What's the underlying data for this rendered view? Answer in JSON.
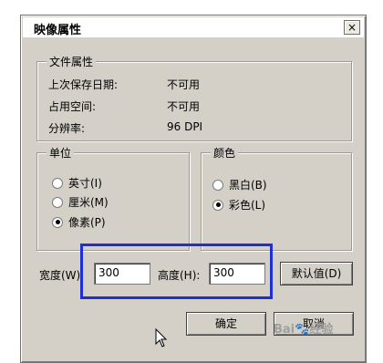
{
  "dialog": {
    "title": "映像属性",
    "close_glyph": "×"
  },
  "file_props": {
    "title": "文件属性",
    "rows": [
      {
        "label": "上次保存日期:",
        "value": "不可用"
      },
      {
        "label": "占用空间:",
        "value": "不可用"
      },
      {
        "label": "分辨率:",
        "value": "96 DPI"
      }
    ]
  },
  "unit": {
    "title": "单位",
    "options": [
      {
        "label": "英寸(I)",
        "selected": false
      },
      {
        "label": "厘米(M)",
        "selected": false
      },
      {
        "label": "像素(P)",
        "selected": true
      }
    ]
  },
  "color": {
    "title": "颜色",
    "options": [
      {
        "label": "黑白(B)",
        "selected": false
      },
      {
        "label": "彩色(L)",
        "selected": true
      }
    ]
  },
  "size": {
    "width_label": "宽度(W)",
    "width_value": "300",
    "height_label": "高度(H):",
    "height_value": "300",
    "default_button": "默认值(D)"
  },
  "buttons": {
    "ok": "确定",
    "cancel": "取消"
  },
  "watermark": "Bai🐾经验",
  "colors": {
    "highlight": "#1f2fd6",
    "dialog_bg": "#d4d0c8"
  }
}
